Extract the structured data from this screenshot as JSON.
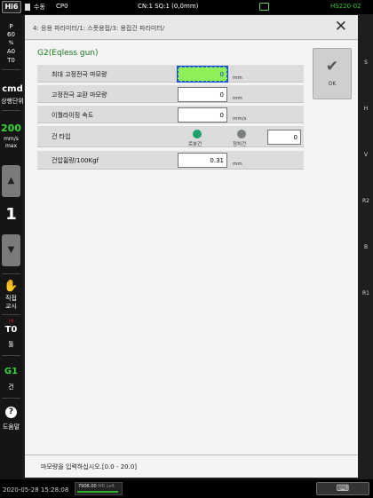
{
  "topbar": {
    "badge": "Hi6",
    "mode": "수동",
    "cp": "CP0",
    "cn": "CN:1 SQ:1 (0,0mm)",
    "system": "HS220-02"
  },
  "left": {
    "p_label": "P",
    "p_value": "60",
    "p_unit": "%",
    "a_label": "A0",
    "t_label": "T0",
    "cmd": "cmd",
    "cmd_sub": "상행단위",
    "speed": "200",
    "speed_unit1": "mm/s",
    "speed_unit2": "max",
    "step_value": "1",
    "direct": "직접",
    "direct2": "교시",
    "tool_mark": "(r)",
    "tool_value": "T0",
    "tool_label": "툴",
    "gun_value": "G1",
    "gun_label": "건",
    "help_label": "도움말"
  },
  "right": {
    "labels": [
      "S",
      "H",
      "V",
      "R2",
      "B",
      "R1"
    ]
  },
  "panel": {
    "breadcrumb": "4: 응용 파라미터/1: 스폿용접/3: 용접건 파라미터/",
    "section_title": "G2(Eqless gun)",
    "rows": [
      {
        "label": "최대 고정전극 마모량",
        "value": "0",
        "unit": "mm"
      },
      {
        "label": "고정전극 교환 마모량",
        "value": "0",
        "unit": "mm"
      },
      {
        "label": "이퀄라이징 속도",
        "value": "0",
        "unit": "mm/s"
      }
    ],
    "gun_type": {
      "label": "건 타입",
      "option1": "로봇건",
      "option2": "정치건",
      "value": "0"
    },
    "pressure": {
      "label": "건압휨량/100Kgf",
      "value": "0.31",
      "unit": "mm"
    },
    "ok_label": "OK",
    "hint": "마모량을 입력하십시오.[0.0 - 20.0]"
  },
  "bottom": {
    "datetime": "2020-05-28 15:28:08",
    "mem_value": "7906.00",
    "mem_suffix": "MB Left"
  },
  "colors": {
    "active_field": "#8ff05a",
    "section_title": "#1a7a1a",
    "radio_selected": "#1ea06a",
    "radio_unselected": "#7a8080",
    "system_text": "#33cc33"
  }
}
